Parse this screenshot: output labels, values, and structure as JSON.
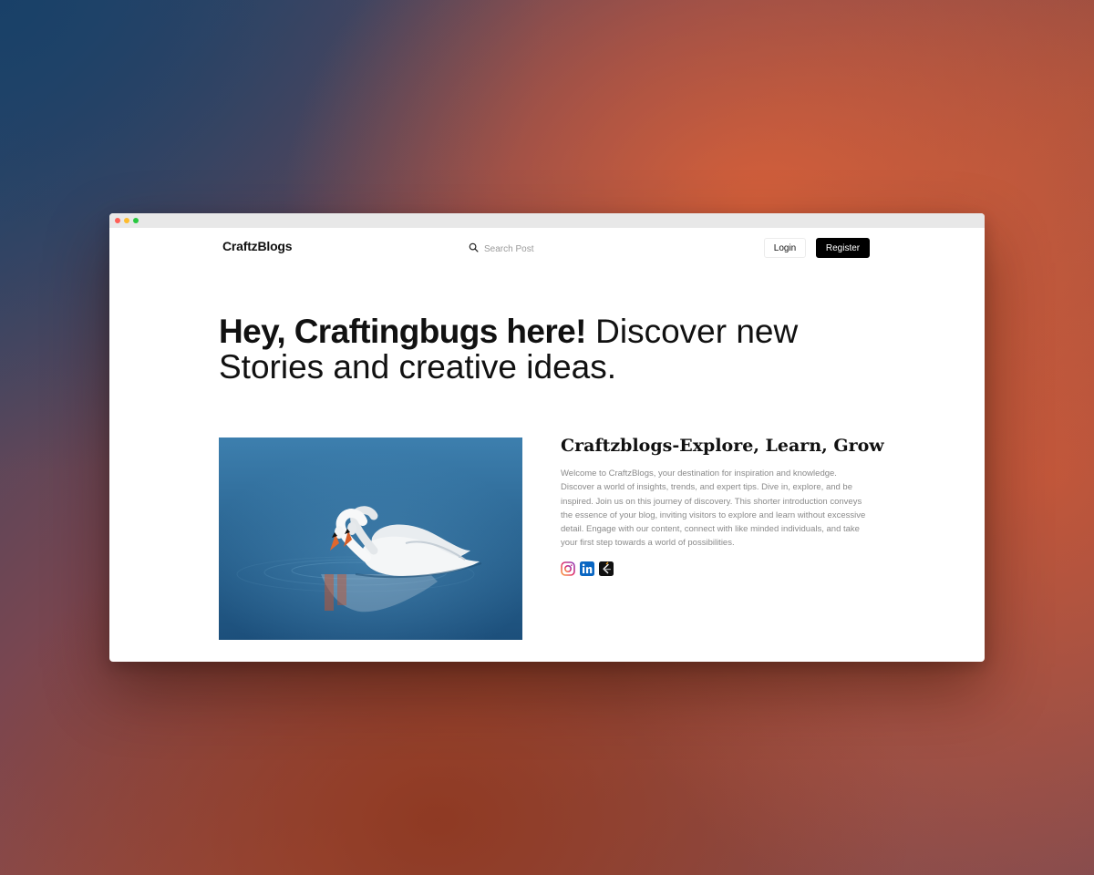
{
  "brand": {
    "name": "CraftzBlogs"
  },
  "search": {
    "placeholder": "Search Post",
    "icon": "search-icon"
  },
  "auth": {
    "login_label": "Login",
    "register_label": "Register"
  },
  "hero": {
    "title_strong": "Hey, Craftingbugs here!",
    "title_rest": "Discover new Stories and creative ideas."
  },
  "about": {
    "title_brand": "Craftzblogs-",
    "title_rest": "Explore, Learn, Grow",
    "text": "Welcome to CraftzBlogs, your destination for inspiration and knowledge. Discover a world of insights, trends, and expert tips. Dive in, explore, and be inspired. Join us on this journey of discovery. This shorter introduction conveys the essence of your blog, inviting visitors to explore and learn without excessive detail. Engage with our content, connect with like minded individuals, and take your first step towards a world of possibilities."
  },
  "socials": [
    {
      "name": "instagram-icon"
    },
    {
      "name": "linkedin-icon"
    },
    {
      "name": "leetcode-icon"
    }
  ],
  "colors": {
    "primary_button": "#000000",
    "text": "#111111",
    "muted_text": "#8a8a8a",
    "water": "#2f6690"
  }
}
